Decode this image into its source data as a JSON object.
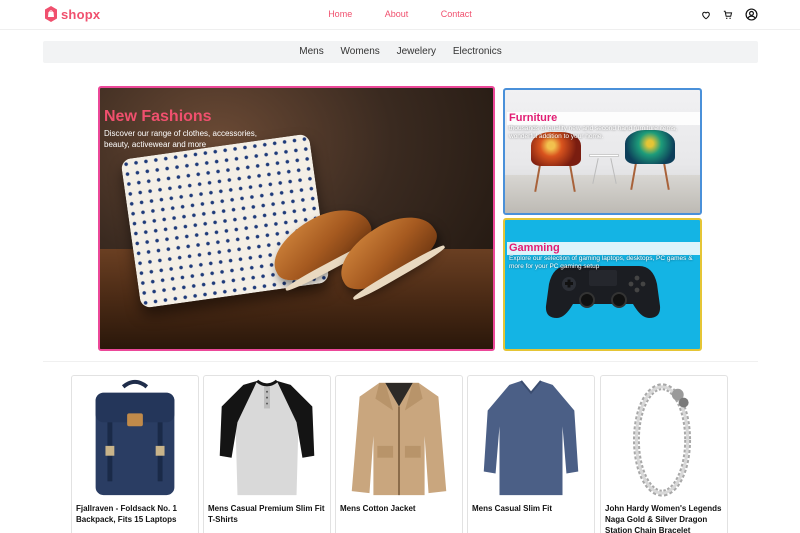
{
  "brand": {
    "name": "shopx",
    "color": "#f0506e"
  },
  "nav": {
    "items": [
      "Home",
      "About",
      "Contact"
    ]
  },
  "header_icons": [
    "heart-icon",
    "cart-icon",
    "user-icon"
  ],
  "categories": [
    "Mens",
    "Womens",
    "Jewelery",
    "Electronics"
  ],
  "hero": {
    "main": {
      "title": "New Fashions",
      "description": "Discover our range of clothes, accessories, beauty, activewear and more"
    },
    "furniture": {
      "title": "Furniture",
      "description": "thousands of quality new and second hand furniture items, wonderful addition to your home."
    },
    "gaming": {
      "title": "Gamming",
      "description": "Explore our selection of gaming laptops, desktops, PC games & more for your PC gaming setup"
    }
  },
  "products": [
    {
      "title": "Fjallraven - Foldsack No. 1 Backpack, Fits 15 Laptops"
    },
    {
      "title": "Mens Casual Premium Slim Fit T-Shirts"
    },
    {
      "title": "Mens Cotton Jacket"
    },
    {
      "title": "Mens Casual Slim Fit"
    },
    {
      "title": "John Hardy Women's Legends Naga Gold & Silver Dragon Station Chain Bracelet"
    }
  ]
}
